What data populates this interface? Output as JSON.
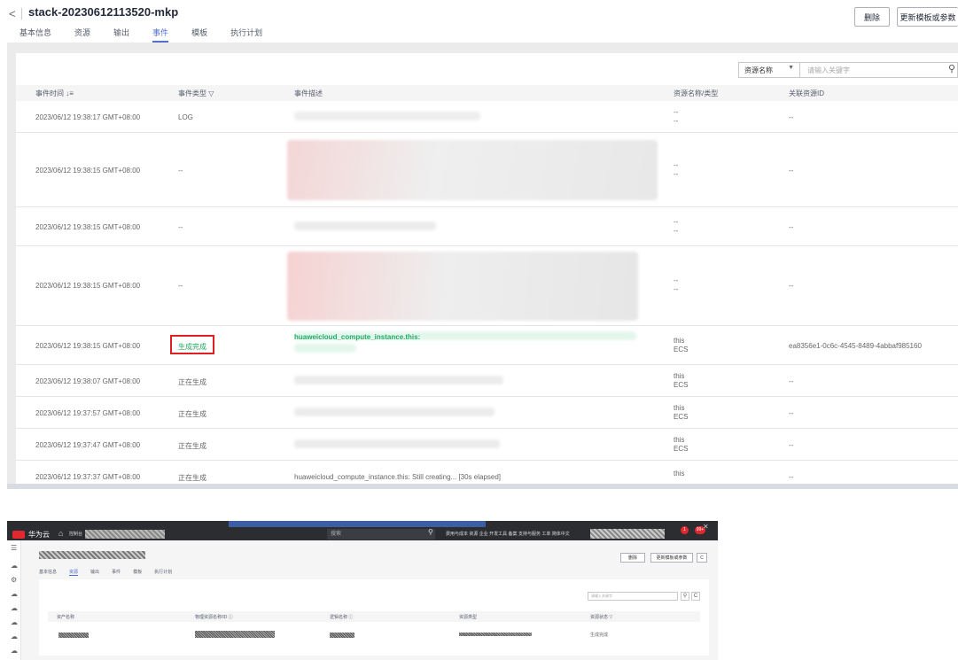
{
  "stack": {
    "title": "stack-20230612113520-mkp",
    "delete_label": "删除",
    "update_label": "更新模板或参数",
    "tabs": [
      "基本信息",
      "资源",
      "输出",
      "事件",
      "模板",
      "执行计划"
    ],
    "active_tab": "事件"
  },
  "filter": {
    "select_value": "资源名称",
    "input_placeholder": "请输入关键字"
  },
  "table": {
    "headers": [
      "事件时间",
      "事件类型",
      "事件描述",
      "资源名称/类型",
      "关联资源ID"
    ],
    "rows": [
      {
        "time": "2023/06/12 19:38:17 GMT+08:00",
        "type": "LOG",
        "desc": "",
        "res_name": "--",
        "res_type": "--",
        "res_id": "--"
      },
      {
        "time": "2023/06/12 19:38:15 GMT+08:00",
        "type": "--",
        "desc": "",
        "res_name": "--",
        "res_type": "--",
        "res_id": "--"
      },
      {
        "time": "2023/06/12 19:38:15 GMT+08:00",
        "type": "--",
        "desc": "",
        "res_name": "--",
        "res_type": "--",
        "res_id": "--"
      },
      {
        "time": "2023/06/12 19:38:15 GMT+08:00",
        "type": "--",
        "desc": "",
        "res_name": "--",
        "res_type": "--",
        "res_id": "--"
      },
      {
        "time": "2023/06/12 19:38:15 GMT+08:00",
        "type": "生成完成",
        "desc": "huaweicloud_compute_instance.this:",
        "res_name": "this",
        "res_type": "ECS",
        "res_id": "ea8356e1-0c6c-4545-8489-4abbaf985160"
      },
      {
        "time": "2023/06/12 19:38:07 GMT+08:00",
        "type": "正在生成",
        "desc": "",
        "res_name": "this",
        "res_type": "ECS",
        "res_id": "--"
      },
      {
        "time": "2023/06/12 19:37:57 GMT+08:00",
        "type": "正在生成",
        "desc": "",
        "res_name": "this",
        "res_type": "ECS",
        "res_id": "--"
      },
      {
        "time": "2023/06/12 19:37:47 GMT+08:00",
        "type": "正在生成",
        "desc": "",
        "res_name": "this",
        "res_type": "ECS",
        "res_id": "--"
      },
      {
        "time": "2023/06/12 19:37:37 GMT+08:00",
        "type": "正在生成",
        "desc": "huaweicloud_compute_instance.this: Still creating... [30s elapsed]",
        "res_name": "this",
        "res_type": "",
        "res_id": "--"
      }
    ]
  },
  "console": {
    "brand": "华为云",
    "console_label": "控制台",
    "search_placeholder": "搜索",
    "nav_items": "费用与成本  资源  企业  开发工具  备案  支持与服务  工单  简体中文",
    "badge1": "1",
    "badge2": "99+",
    "delete_label": "删除",
    "update_label": "更新模板或参数",
    "tabs": [
      "基本信息",
      "资源",
      "输出",
      "事件",
      "模板",
      "执行计划"
    ],
    "active_tab": "资源",
    "input_placeholder": "请输入关键字",
    "headers": [
      "资产名称",
      "物理资源名称/ID",
      "逻辑名称",
      "资源类型",
      "资源状态"
    ],
    "row_status": "生成完成"
  }
}
